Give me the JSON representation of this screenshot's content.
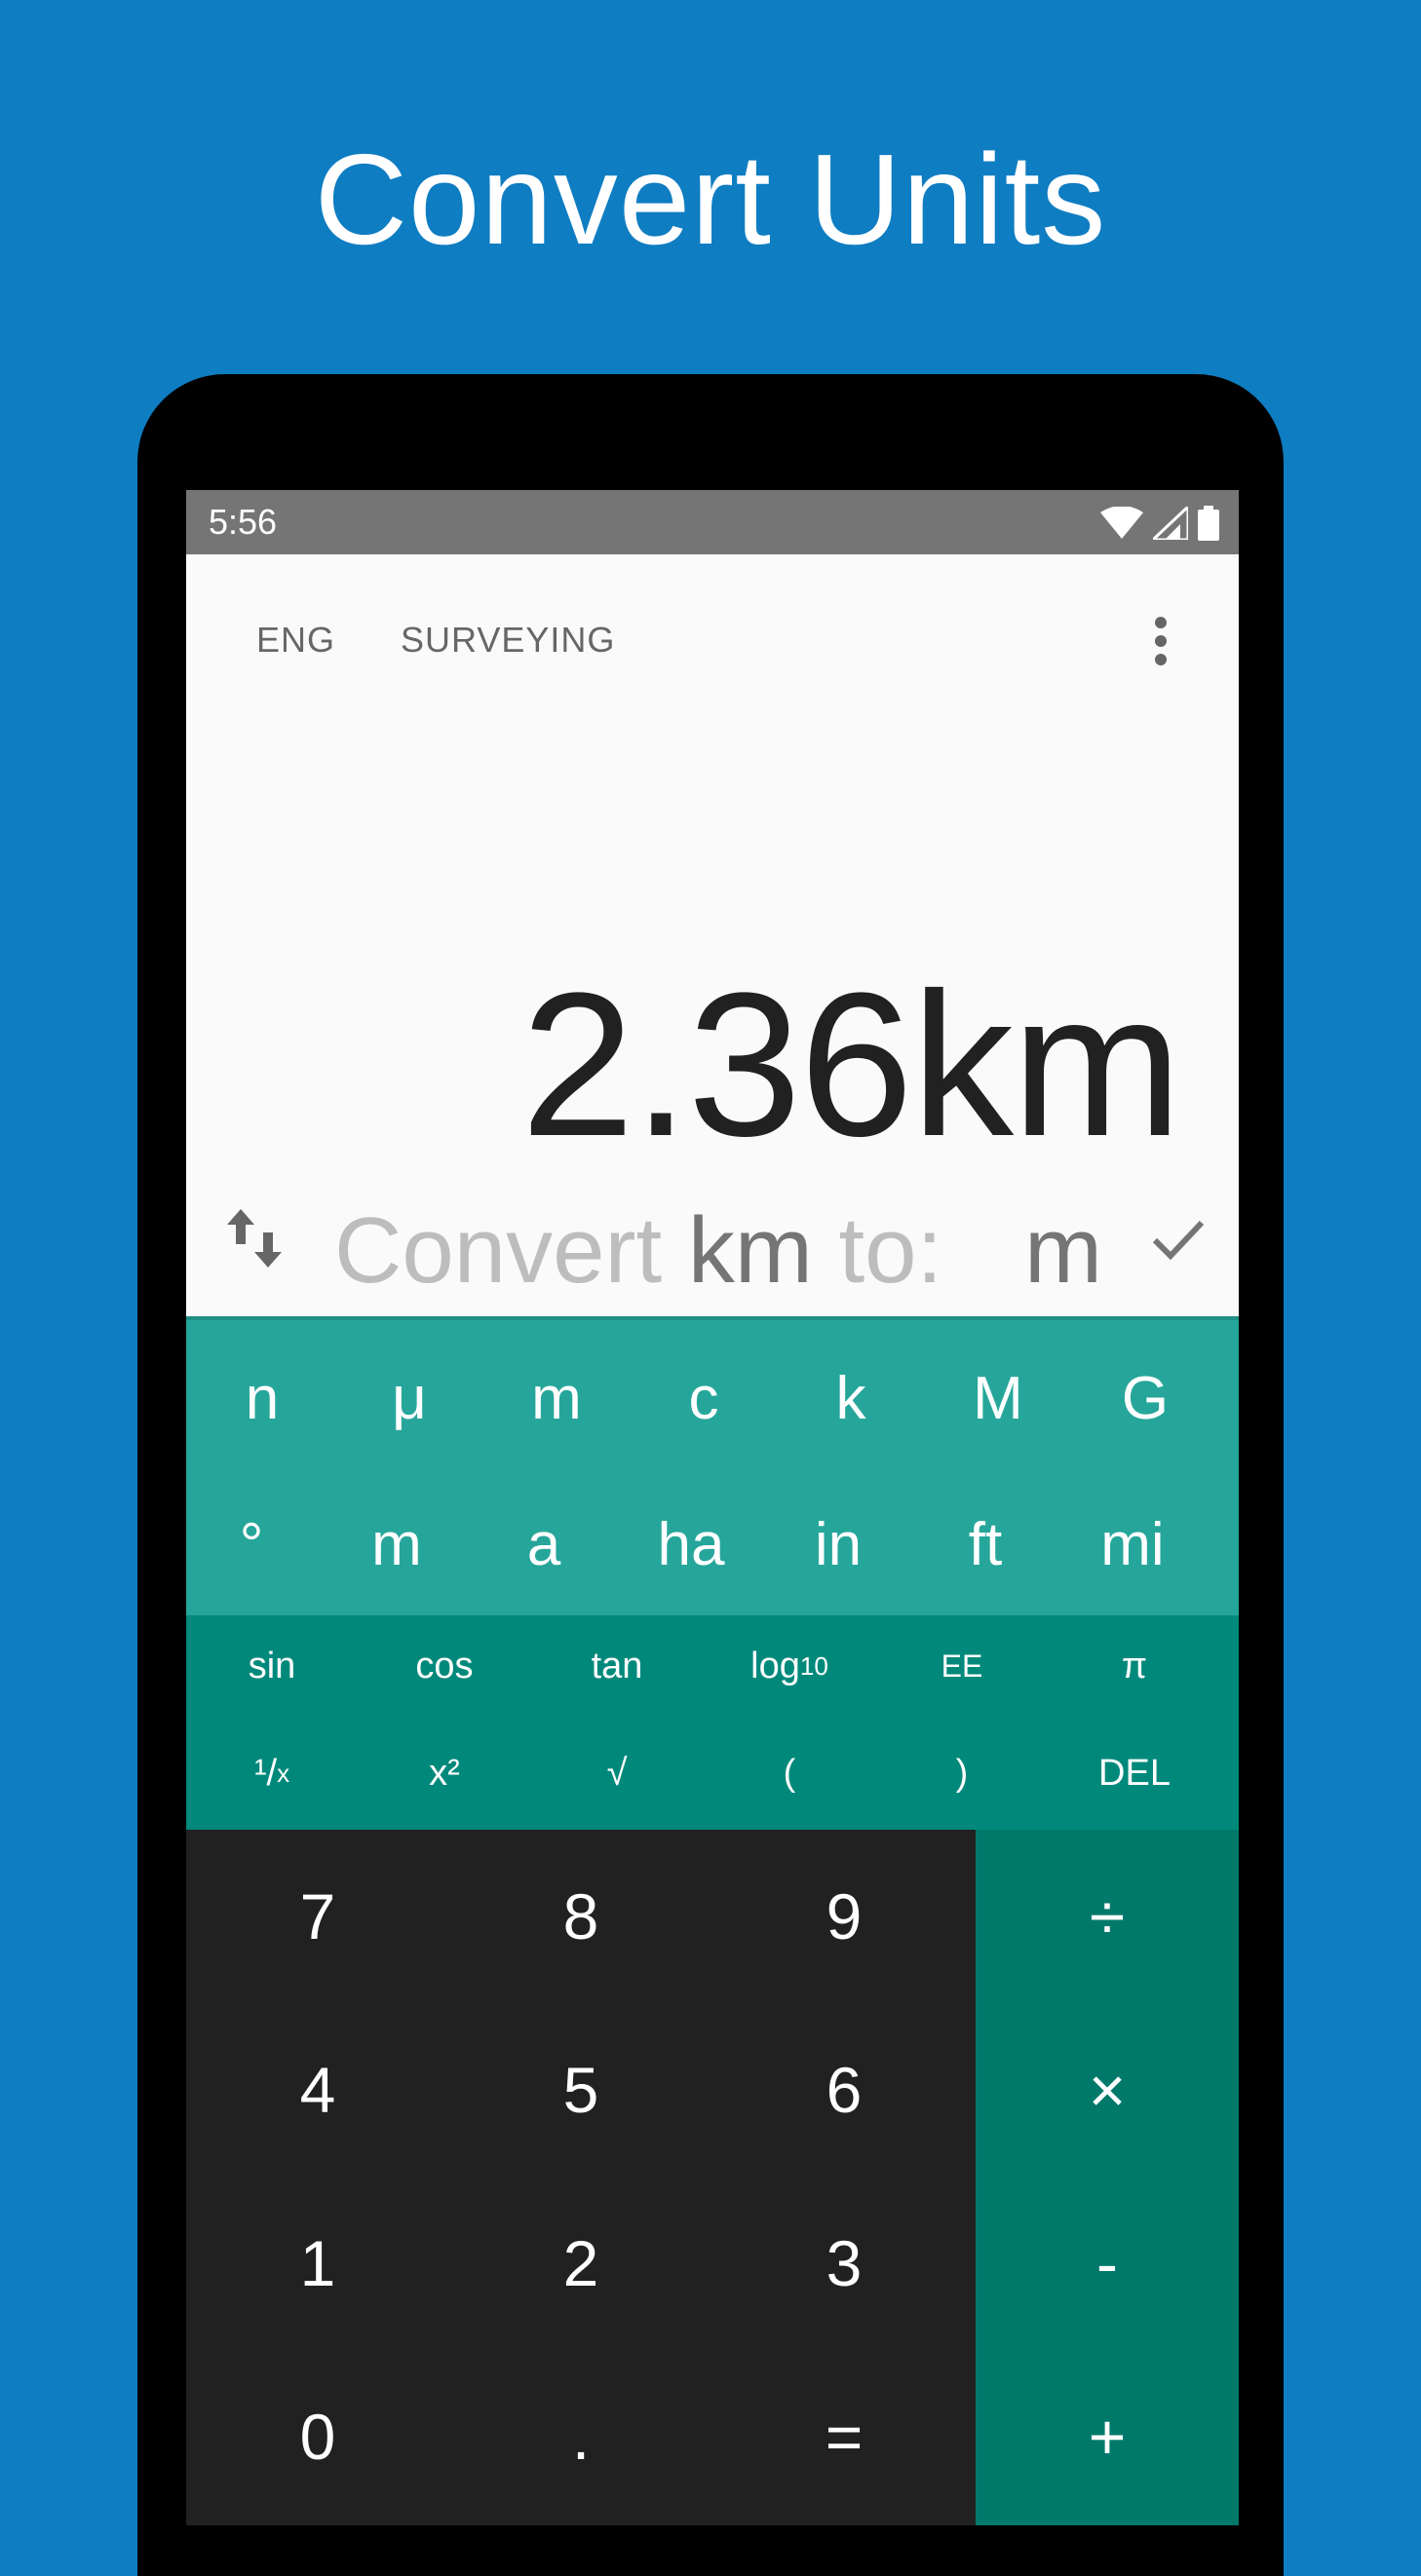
{
  "headline": "Convert Units",
  "status_bar": {
    "time": "5:56",
    "icons": [
      "wifi-icon",
      "signal-icon",
      "battery-icon"
    ]
  },
  "tabs": [
    {
      "label": "ENG"
    },
    {
      "label": "SURVEYING"
    }
  ],
  "display": {
    "value": "2.36km"
  },
  "convert": {
    "prefix": "Convert ",
    "unit": "km",
    "suffix": " to:",
    "target": "m"
  },
  "unit_keys": {
    "row1": [
      "n",
      "μ",
      "m",
      "c",
      "k",
      "M",
      "G"
    ],
    "row2": [
      "°",
      "m",
      "a",
      "ha",
      "in",
      "ft",
      "mi"
    ]
  },
  "function_keys": {
    "row1": [
      "sin",
      "cos",
      "tan",
      "log",
      "EE",
      "π"
    ],
    "row1_log_sub": "10",
    "row2": [
      "¹/",
      "x²",
      "√",
      "(",
      ")",
      "DEL"
    ],
    "row2_recip_sub": "x"
  },
  "number_keys": [
    [
      "7",
      "8",
      "9"
    ],
    [
      "4",
      "5",
      "6"
    ],
    [
      "1",
      "2",
      "3"
    ],
    [
      "0",
      ".",
      "="
    ]
  ],
  "operator_keys": [
    "÷",
    "×",
    "-",
    "+"
  ],
  "colors": {
    "background": "#0f7dc2",
    "units_pad": "#26a69a",
    "function_pad": "#00897b",
    "number_pad": "#212121",
    "operator_pad": "#00796b"
  }
}
